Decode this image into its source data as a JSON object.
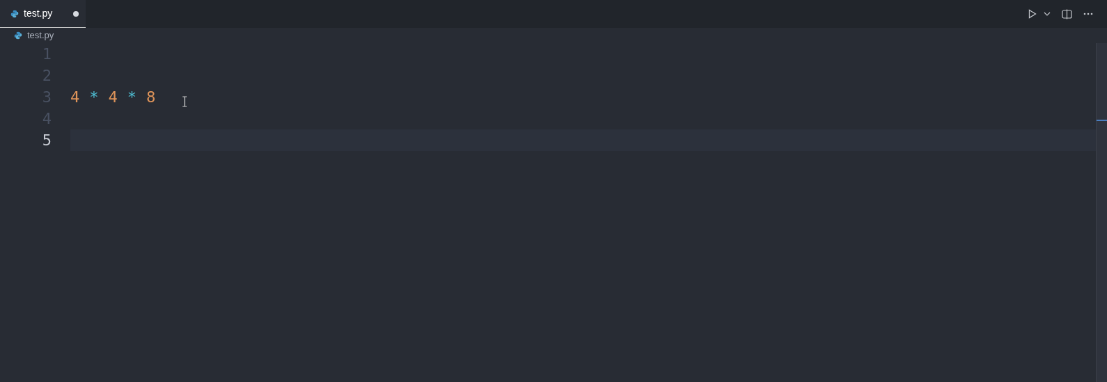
{
  "tabs": [
    {
      "label": "test.py",
      "selected": true,
      "modified": true
    }
  ],
  "breadcrumb": {
    "file": "test.py"
  },
  "editor": {
    "lines": [
      {
        "number": "1",
        "selected": false
      },
      {
        "number": "2",
        "selected": false
      },
      {
        "number": "3",
        "selected": false,
        "tokens": [
          {
            "text": "4",
            "kind": "number"
          },
          {
            "text": "*",
            "kind": "operator"
          },
          {
            "text": "4",
            "kind": "number"
          },
          {
            "text": "*",
            "kind": "operator"
          },
          {
            "text": "8",
            "kind": "number"
          }
        ]
      },
      {
        "number": "4",
        "selected": false
      },
      {
        "number": "5",
        "selected": true
      }
    ]
  }
}
